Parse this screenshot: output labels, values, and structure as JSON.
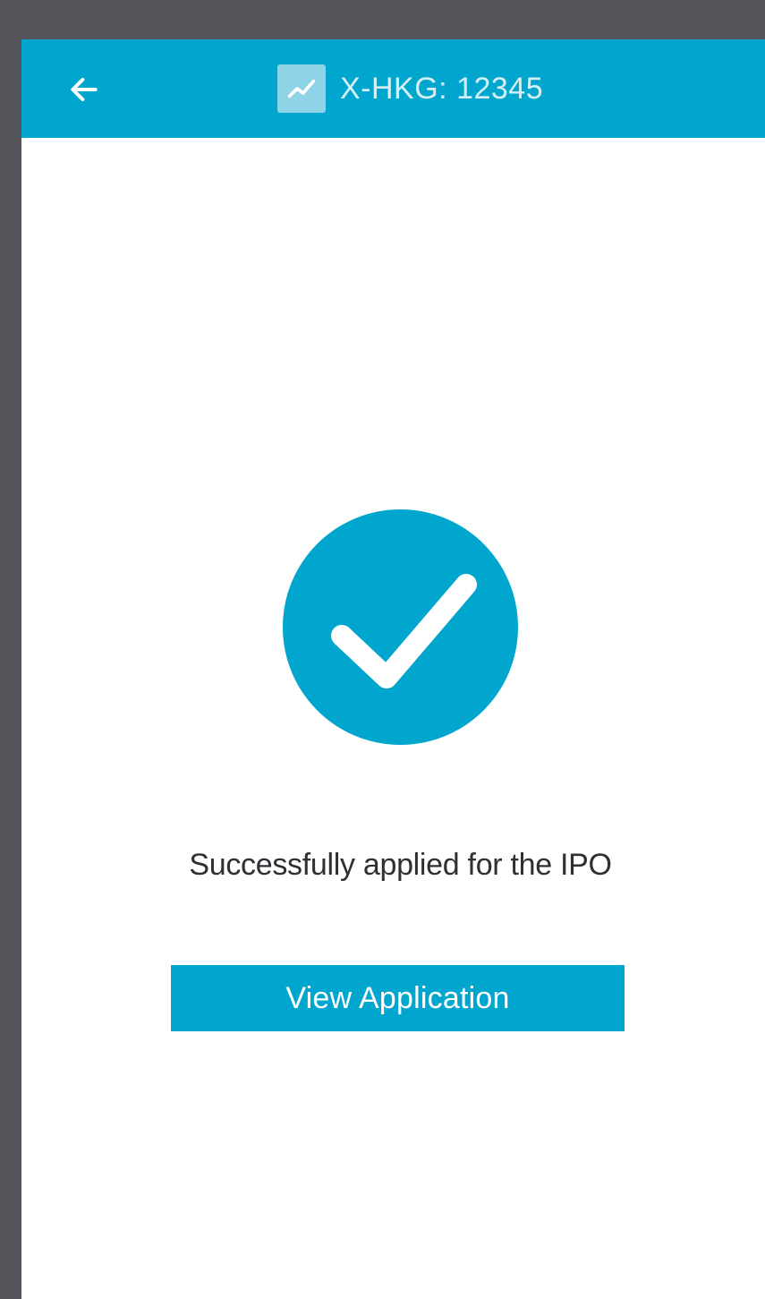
{
  "header": {
    "title": "X-HKG: 12345",
    "back_icon": "arrow-left-icon",
    "logo_icon": "stock-chart-icon"
  },
  "main": {
    "status_icon": "check-circle-icon",
    "message": "Successfully applied for the IPO",
    "primary_button_label": "View Application"
  },
  "colors": {
    "accent": "#00a6cd",
    "background": "#ffffff",
    "frame": "#54565b",
    "text": "#2f2f34"
  }
}
